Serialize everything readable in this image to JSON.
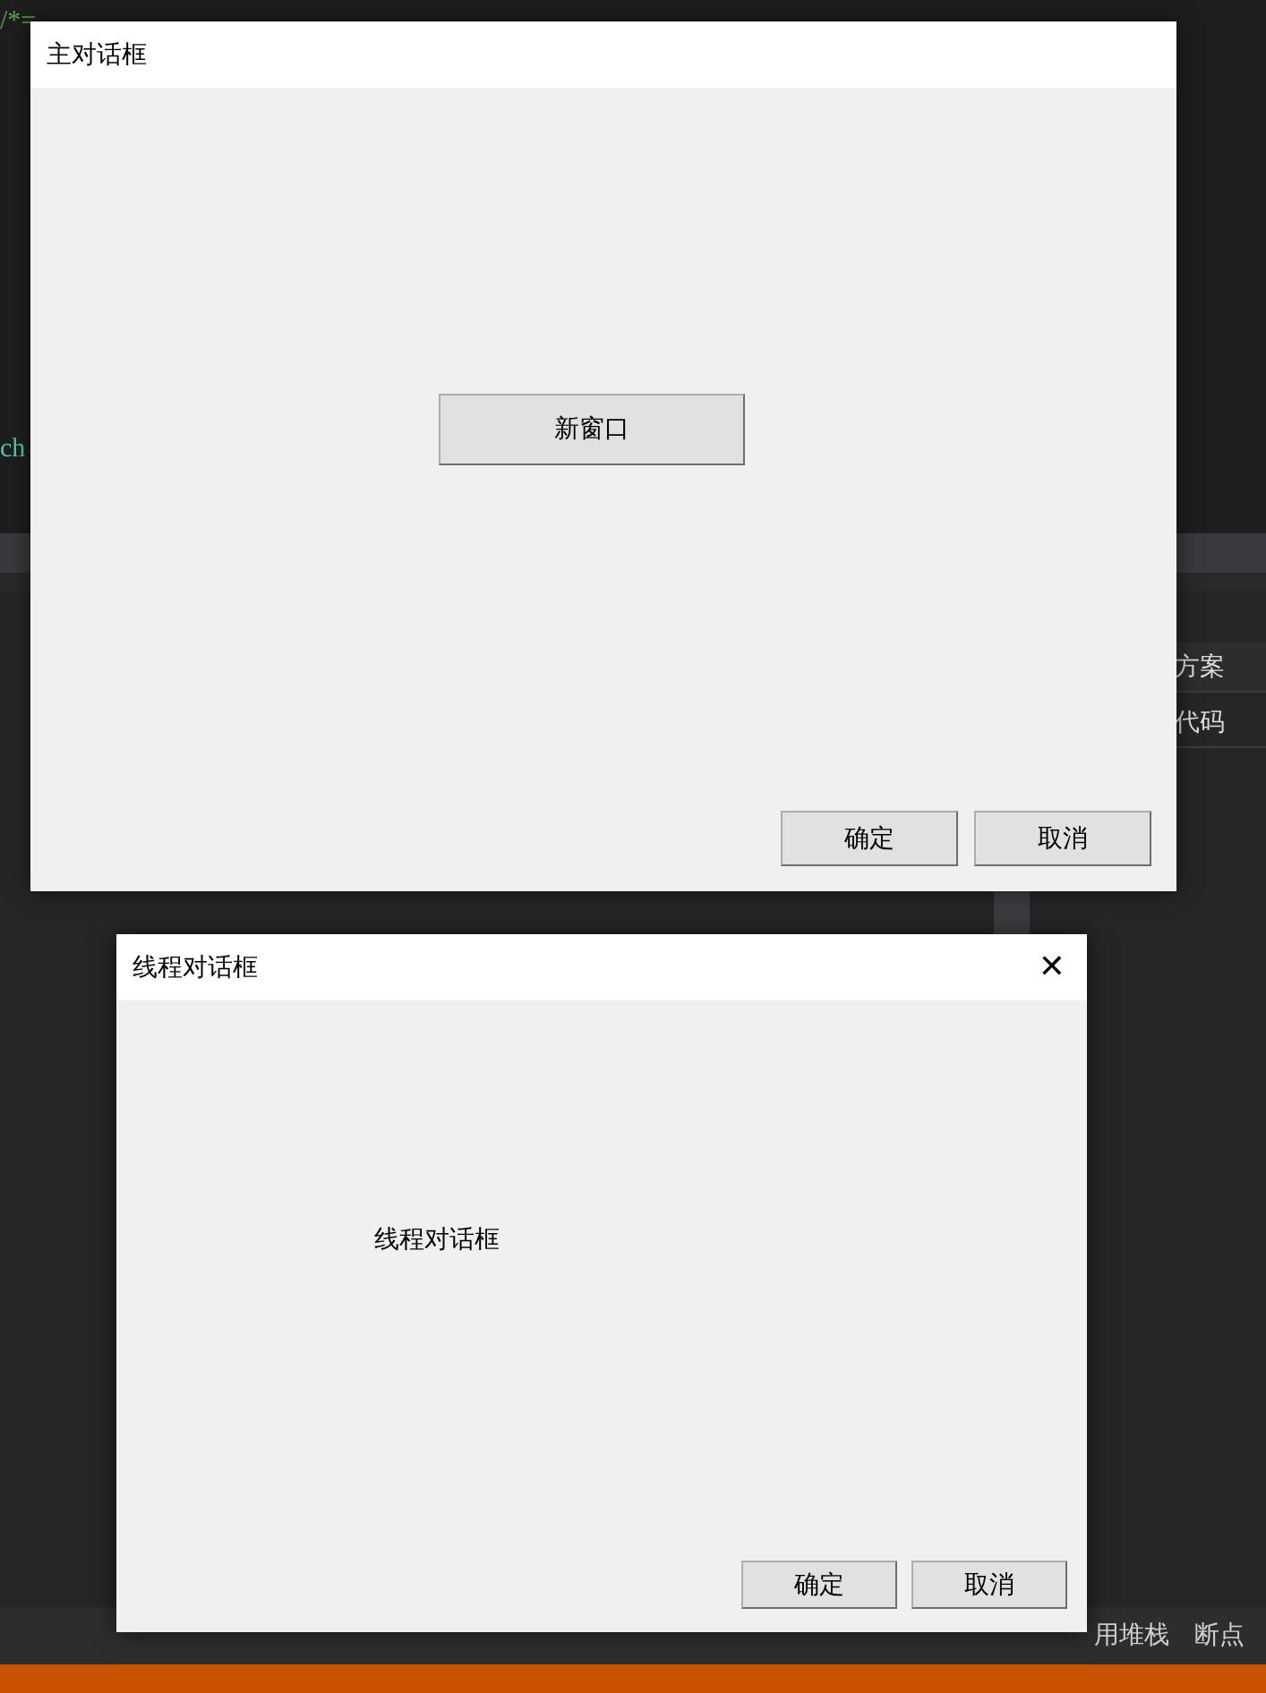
{
  "ide": {
    "code_lines": [
      "/*=",
      "ch"
    ],
    "explorer_items": [
      "方案",
      "代码"
    ],
    "bottom_tabs": [
      "用堆栈",
      "断点"
    ]
  },
  "main_dialog": {
    "title": "主对话框",
    "button": "新窗口",
    "ok": "确定",
    "cancel": "取消"
  },
  "thread_dialog": {
    "title": "线程对话框",
    "close": "✕",
    "label": "线程对话框",
    "ok": "确定",
    "cancel": "取消"
  }
}
